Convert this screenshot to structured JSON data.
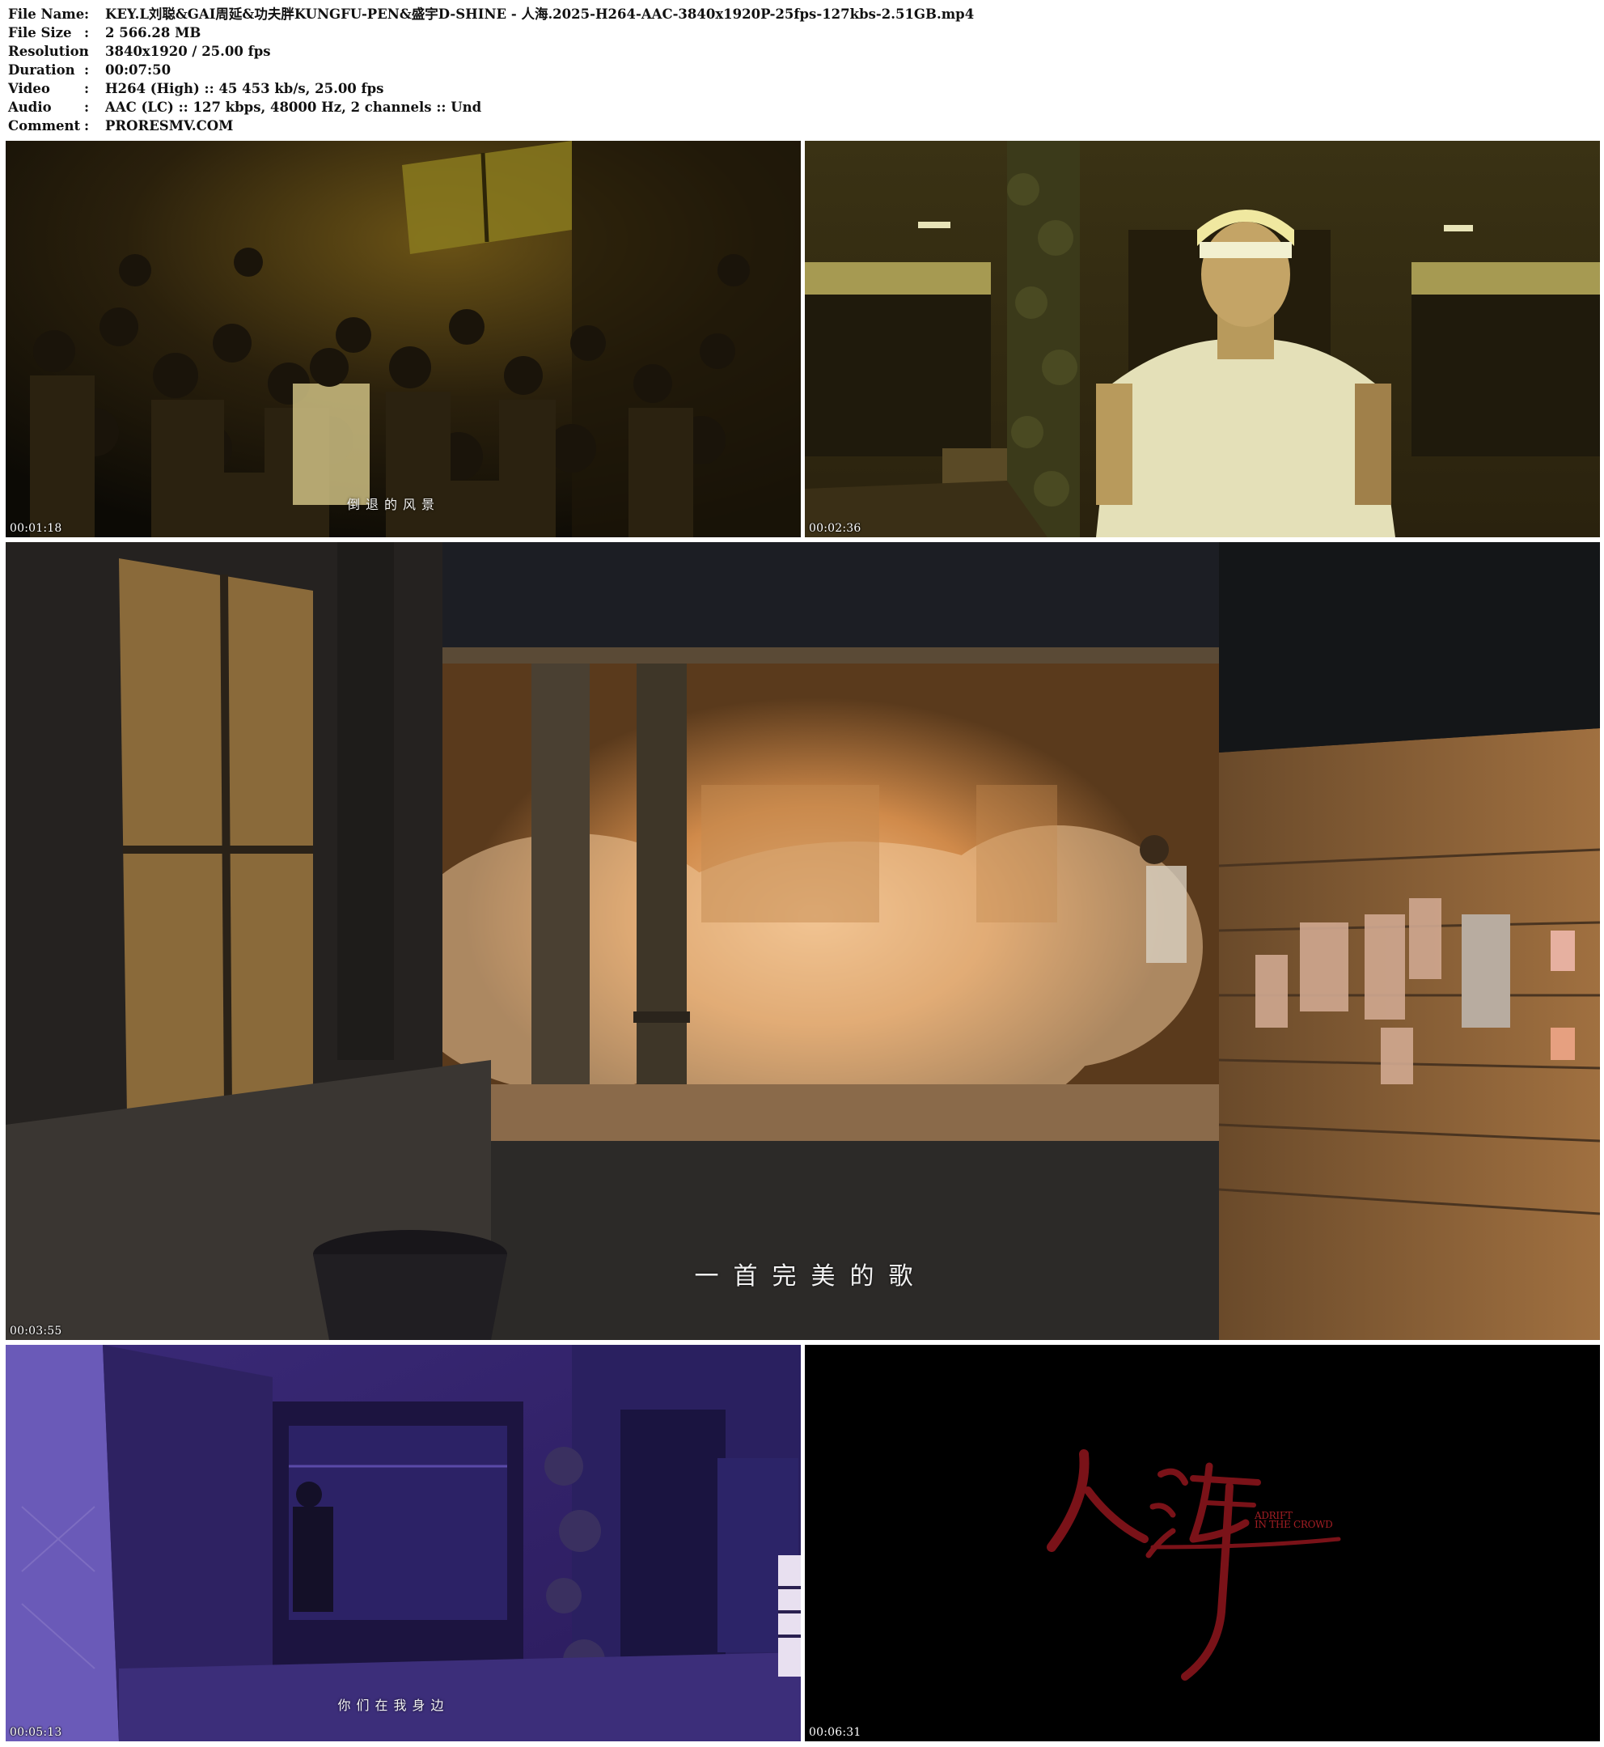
{
  "info": [
    {
      "key": "File Name",
      "sep": ":",
      "value": "KEY.L刘聪&GAI周延&功夫胖KUNGFU-PEN&盛宇D-SHINE - 人海.2025-H264-AAC-3840x1920P-25fps-127kbs-2.51GB.mp4"
    },
    {
      "key": "File Size",
      "sep": ":",
      "value": "2 566.28 MB"
    },
    {
      "key": "Resolution",
      "sep": ":",
      "value": "3840x1920 / 25.00 fps"
    },
    {
      "key": "Duration",
      "sep": ":",
      "value": "00:07:50"
    },
    {
      "key": "Video",
      "sep": ":",
      "value": "H264 (High) :: 45 453 kb/s, 25.00 fps"
    },
    {
      "key": "Audio",
      "sep": ":",
      "value": "AAC (LC) :: 127 kbps, 48000 Hz, 2 channels :: Und"
    },
    {
      "key": "Comment",
      "sep": ":",
      "value": "PRORESMV.COM"
    }
  ],
  "thumbnails": [
    {
      "timestamp": "00:01:18",
      "subtitle": "倒退的风景",
      "scene": "crowd"
    },
    {
      "timestamp": "00:02:36",
      "subtitle": "",
      "scene": "performer-white-shirt"
    },
    {
      "timestamp": "00:03:55",
      "subtitle": "一首完美的歌",
      "scene": "smoke-alley"
    },
    {
      "timestamp": "00:05:13",
      "subtitle": "你们在我身边",
      "scene": "purple-alley"
    },
    {
      "timestamp": "00:06:31",
      "subtitle": "",
      "scene": "title-card"
    }
  ],
  "title_card": {
    "logo_text": "人海",
    "tagline_line1": "ADRIFT",
    "tagline_line2": "IN THE CROWD",
    "logo_color": "#7a1218"
  }
}
